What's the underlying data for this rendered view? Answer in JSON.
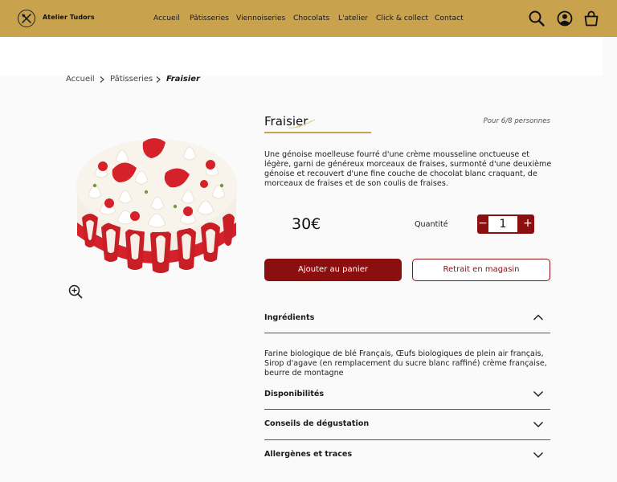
{
  "header": {
    "brand": "Atelier Tudors",
    "nav": [
      "Accueil",
      "Pâtisseries",
      "Viennoiseries",
      "Chocolats",
      "L'atelier",
      "Click & collect",
      "Contact"
    ],
    "icons": [
      "search-icon",
      "account-icon",
      "basket-icon"
    ],
    "bg_color": "#c9a24d"
  },
  "breadcrumb": {
    "items": [
      "Accueil",
      "Pâtisseries"
    ],
    "current": "Fraisier"
  },
  "product": {
    "title": "Fraisier",
    "serves": "Pour 6/8 personnes",
    "description": "Une génoise moelleuse fourré d'une crème mousseline onctueuse et légère, garni de généreux morceaux de fraises, surmonté d'une deuxième génoise et recouvert d'une fine couche de chocolat blanc craquant, de morceaux de fraises et de son coulis de fraises.",
    "price": "30€",
    "quantity_label": "Quantité",
    "quantity": "1",
    "minus": "−",
    "plus": "+",
    "add_to_cart": "Ajouter au panier",
    "pickup": "Retrait en magasin",
    "accent_color": "#8b0f0f"
  },
  "accordions": [
    {
      "title": "Ingrédients",
      "expanded": true,
      "content": "Farine biologique de blé Français, Œufs biologiques de plein air français, Sirop d'agave (en remplacement du sucre blanc raffiné) crème française, beurre de montagne"
    },
    {
      "title": "Disponibilités",
      "expanded": false
    },
    {
      "title": "Conseils de dégustation",
      "expanded": false
    },
    {
      "title": "Allergènes et traces",
      "expanded": false
    }
  ]
}
